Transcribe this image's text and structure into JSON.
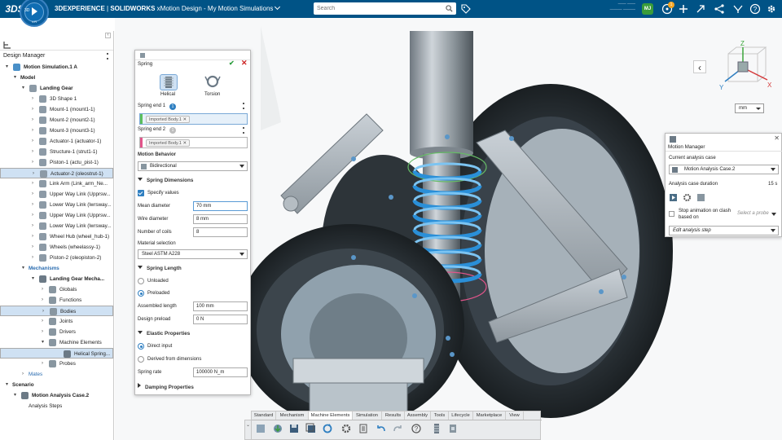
{
  "topbar": {
    "brand_symbol": "3DS",
    "compass_label": "3D",
    "compass_version": "V.R",
    "brand": "3DEXPERIENCE",
    "product": "SOLIDWORKS",
    "app": "xMotion Design",
    "document": "My Motion Simulations",
    "search_placeholder": "Search",
    "notification_count": "1",
    "user_badge": "MJ",
    "colors": {
      "bar": "#005386",
      "accent": "#2f7fc1"
    },
    "icons": [
      "tag-icon",
      "add-icon",
      "share-icon",
      "social-icon",
      "help-icon",
      "settings-icon"
    ]
  },
  "design_manager": {
    "title": "Design Manager",
    "tree": [
      {
        "label": "Motion Simulation.1 A",
        "level": 0,
        "style": "bold",
        "icon": "motion-sim-icon"
      },
      {
        "label": "Model",
        "level": 1,
        "style": "bold",
        "icon": ""
      },
      {
        "label": "Landing Gear",
        "level": 2,
        "style": "bold",
        "icon": "assembly-icon"
      },
      {
        "label": "3D Shape 1",
        "level": 3,
        "icon": "part-icon"
      },
      {
        "label": "Mount-1 (mount1-1)",
        "level": 3,
        "icon": "part-icon"
      },
      {
        "label": "Mount-2 (mount2-1)",
        "level": 3,
        "icon": "part-icon"
      },
      {
        "label": "Mount-3 (mount3-1)",
        "level": 3,
        "icon": "part-icon"
      },
      {
        "label": "Actuator-1 (actuator-1)",
        "level": 3,
        "icon": "part-icon"
      },
      {
        "label": "Structure-1 (strut1-1)",
        "level": 3,
        "icon": "part-icon"
      },
      {
        "label": "Piston-1 (actu_pist-1)",
        "level": 3,
        "icon": "part-icon"
      },
      {
        "label": "Actuator-2 (oleostrut-1)",
        "level": 3,
        "icon": "part-icon",
        "selected": true
      },
      {
        "label": "Link Arm (Link_arm_Ne...",
        "level": 3,
        "icon": "part-icon"
      },
      {
        "label": "Upper Way Link (Upprsw...",
        "level": 3,
        "icon": "part-icon"
      },
      {
        "label": "Lower Way Link (lwrsway...",
        "level": 3,
        "icon": "part-icon"
      },
      {
        "label": "Upper Way Link (Upprsw...",
        "level": 3,
        "icon": "part-icon"
      },
      {
        "label": "Lower Way Link (lwrsway...",
        "level": 3,
        "icon": "part-icon"
      },
      {
        "label": "Wheel Hub (wheel_hub-1)",
        "level": 3,
        "icon": "part-icon"
      },
      {
        "label": "Wheels (wheelassy-1)",
        "level": 3,
        "icon": "part-icon"
      },
      {
        "label": "Piston-2 (oleopiston-2)",
        "level": 3,
        "icon": "part-icon"
      },
      {
        "label": "Mechanisms",
        "level": 2,
        "style": "blue",
        "icon": ""
      },
      {
        "label": "Landing Gear Mecha...",
        "level": 3,
        "style": "bold",
        "icon": "mechanism-icon"
      },
      {
        "label": "Globals",
        "level": 4,
        "icon": "globals-icon"
      },
      {
        "label": "Functions",
        "level": 4,
        "icon": "functions-icon"
      },
      {
        "label": "Bodies",
        "level": 4,
        "icon": "bodies-icon",
        "selected": true
      },
      {
        "label": "Joints",
        "level": 4,
        "icon": "joints-icon"
      },
      {
        "label": "Drivers",
        "level": 4,
        "icon": "drivers-icon"
      },
      {
        "label": "Machine Elements",
        "level": 4,
        "icon": "machine-elements-icon"
      },
      {
        "label": "Helical Spring...",
        "level": 5,
        "icon": "spring-icon",
        "selected": true
      },
      {
        "label": "Probes",
        "level": 4,
        "icon": "probes-icon"
      },
      {
        "label": "Mates",
        "level": 2,
        "style": "blue-light",
        "icon": ""
      },
      {
        "label": "Scenario",
        "level": 0,
        "style": "bold",
        "icon": ""
      },
      {
        "label": "Motion Analysis Case.2",
        "level": 1,
        "style": "bold",
        "icon": "analysis-case-icon"
      },
      {
        "label": "Analysis Steps",
        "level": 2,
        "icon": ""
      }
    ]
  },
  "spring_panel": {
    "title": "Spring",
    "types": [
      {
        "label": "Helical",
        "active": true
      },
      {
        "label": "Torsion",
        "active": false
      }
    ],
    "end1_label": "Spring end 1",
    "end1_count": "1",
    "end1_value": "Imported Body.1",
    "end2_label": "Spring end 2",
    "end2_count": "1",
    "end2_value": "Imported Body.1",
    "behavior_label": "Motion Behavior",
    "behavior_value": "Bidirectional",
    "dimensions_header": "Spring Dimensions",
    "specify_values": "Specify values",
    "mean_diameter_label": "Mean diameter",
    "mean_diameter_value": "70 mm",
    "wire_diameter_label": "Wire diameter",
    "wire_diameter_value": "8 mm",
    "coils_label": "Number of coils",
    "coils_value": "8",
    "material_label": "Material selection",
    "material_value": "Steel ASTM A228",
    "length_header": "Spring Length",
    "unloaded": "Unloaded",
    "preloaded": "Preloaded",
    "assembled_label": "Assembled length",
    "assembled_value": "100 mm",
    "preload_label": "Design preload",
    "preload_value": "0 N",
    "elastic_header": "Elastic Properties",
    "direct_input": "Direct input",
    "derived": "Derived from dimensions",
    "rate_label": "Spring rate",
    "rate_value": "100000 N_m",
    "damping_header": "Damping Properties"
  },
  "motion_manager": {
    "title": "Motion Manager",
    "case_label": "Current analysis case",
    "case_value": "Motion Analysis Case.2",
    "duration_label": "Analysis case duration",
    "duration_value": "15 s",
    "stop_label": "Stop animation on clash based on",
    "probe_placeholder": "Select a probe",
    "edit_step": "Edit analysis step"
  },
  "viewport": {
    "unit": "mm",
    "compass_axes": [
      "X",
      "Y",
      "Z"
    ]
  },
  "toolbar": {
    "tabs": [
      "Standard",
      "Mechanism",
      "Machine Elements",
      "Simulation",
      "Results",
      "Assembly",
      "Tools",
      "Lifecycle",
      "Marketplace",
      "View"
    ],
    "active_tab": "Machine Elements"
  }
}
